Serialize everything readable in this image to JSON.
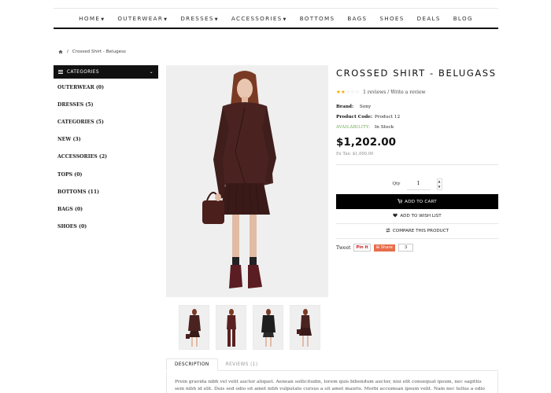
{
  "nav": {
    "items": [
      {
        "label": "HOME",
        "dropdown": true
      },
      {
        "label": "OUTERWEAR",
        "dropdown": true
      },
      {
        "label": "DRESSES",
        "dropdown": true
      },
      {
        "label": "ACCESSORIES",
        "dropdown": true
      },
      {
        "label": "BOTTOMS",
        "dropdown": false
      },
      {
        "label": "BAGS",
        "dropdown": false
      },
      {
        "label": "SHOES",
        "dropdown": false
      },
      {
        "label": "DEALS",
        "dropdown": false
      },
      {
        "label": "BLOG",
        "dropdown": false
      }
    ]
  },
  "breadcrumb": {
    "separator": "/",
    "current": "Crossed Shirt - Belugess"
  },
  "sidebar": {
    "title": "CATEGORIES",
    "items": [
      "OUTERWEAR (0)",
      "DRESSES (5)",
      "CATEGORIES (5)",
      "NEW (3)",
      "ACCESSORIES (2)",
      "TOPS (0)",
      "BOTTOMS (11)",
      "BAGS (0)",
      "SHOES (0)"
    ]
  },
  "product": {
    "title": "CROSSED SHIRT - BELUGASS",
    "rating": 2,
    "rating_max": 5,
    "reviews_text": "1 reviews / Write a review",
    "brand_label": "Brand:",
    "brand": "Sony",
    "code_label": "Product Code:",
    "code": "Product 12",
    "availability_label": "AVAILABILITY:",
    "availability": "In Stock",
    "price": "$1,202.00",
    "ex_tax": "Ex Tax: $1,000.00",
    "qty_label": "Qty",
    "qty_value": "1",
    "add_to_cart": "ADD TO CART",
    "wishlist": "ADD TO WISH LIST",
    "compare": "COMPARE THIS PRODUCT"
  },
  "share": {
    "tweet": "Tweet",
    "pin": "Pin it",
    "share": "Share",
    "count": "3"
  },
  "tabs": {
    "description": "DESCRIPTION",
    "reviews": "REVIEWS (1)"
  },
  "description_text": "Proin gravida nibh vel velit auctor aliquet. Aenean sollicitudin, lorem quis bibendum auctor, nisi elit consequat ipsum, nec sagittis sem nibh id elit. Duis sed odio sit amet nibh vulputate cursus a sit amet mauris. Morbi accumsan ipsum velit. Nam nec tellus a odio",
  "colors": {
    "accent_black": "#000000",
    "star": "#f0ad00",
    "in_stock": "#6aa84f",
    "share": "#e66e4c"
  }
}
